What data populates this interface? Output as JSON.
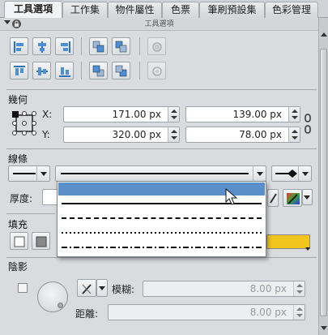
{
  "tabs": [
    {
      "label": "工具選項"
    },
    {
      "label": "工作集"
    },
    {
      "label": "物件屬性"
    },
    {
      "label": "色票"
    },
    {
      "label": "筆刷預設集"
    },
    {
      "label": "色彩管理"
    }
  ],
  "panel_title": "工具選項",
  "geometry": {
    "label": "幾何",
    "x_label": "X:",
    "y_label": "Y:",
    "x_value": "171.00 px",
    "y_value": "320.00 px",
    "width_value": "139.00 px",
    "height_value": "78.00 px"
  },
  "stroke": {
    "label": "線條",
    "thickness_label": "厚度:"
  },
  "fill": {
    "label": "填充",
    "gradient_color": "#f2c51e"
  },
  "shadow": {
    "label": "陰影",
    "blur_label": "模糊:",
    "blur_value": "8.00 px",
    "distance_label": "距離:",
    "distance_value": "8.00 px"
  },
  "line_styles": [
    "solid",
    "dash",
    "dot",
    "dashdot",
    "dashdotdot"
  ],
  "colors": {
    "accent": "#5b8fc9",
    "panel": "#d9dbde"
  }
}
